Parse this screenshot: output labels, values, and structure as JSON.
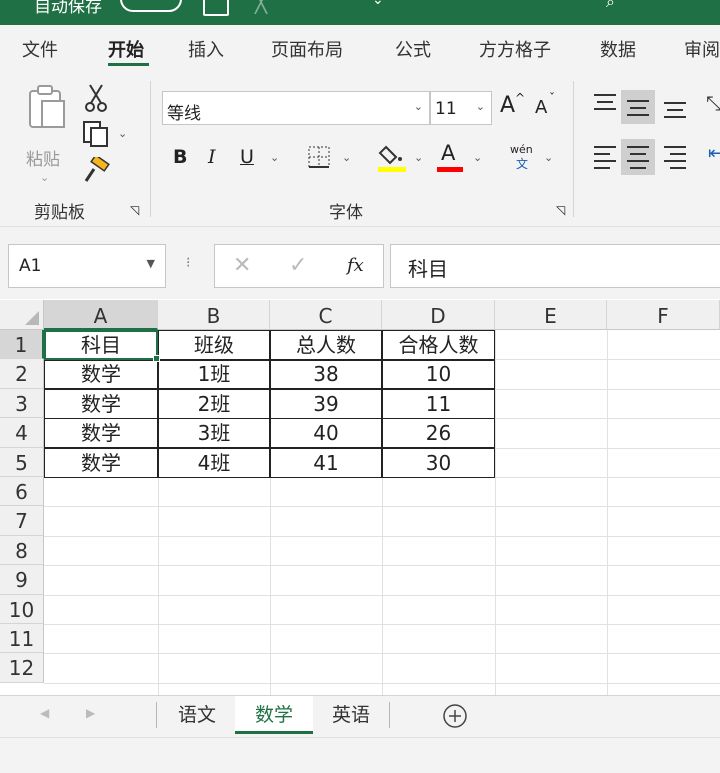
{
  "title_bar": {
    "autosave_label": "自动保存"
  },
  "ribbon_tabs": [
    {
      "label": "文件",
      "active": false
    },
    {
      "label": "开始",
      "active": true
    },
    {
      "label": "插入",
      "active": false
    },
    {
      "label": "页面布局",
      "active": false
    },
    {
      "label": "公式",
      "active": false
    },
    {
      "label": "方方格子",
      "active": false
    },
    {
      "label": "数据",
      "active": false
    },
    {
      "label": "审阅",
      "active": false
    }
  ],
  "clipboard": {
    "paste_label": "粘贴",
    "group_label": "剪贴板"
  },
  "font": {
    "group_label": "字体",
    "font_name": "等线",
    "font_size": "11",
    "grow_font": "A",
    "shrink_font": "A",
    "bold": "B",
    "italic": "I",
    "underline": "U",
    "phonetic_top": "wén",
    "phonetic_bottom": "文",
    "font_color_letter": "A",
    "fill_color": "#ffff00",
    "font_color": "#ff0000"
  },
  "formula_bar": {
    "name_box": "A1",
    "fx_label": "fx",
    "formula": "科目"
  },
  "columns": [
    "A",
    "B",
    "C",
    "D",
    "E",
    "F"
  ],
  "rows": [
    "1",
    "2",
    "3",
    "4",
    "5",
    "6",
    "7",
    "8",
    "9",
    "10",
    "11",
    "12"
  ],
  "cells": [
    [
      "科目",
      "班级",
      "总人数",
      "合格人数"
    ],
    [
      "数学",
      "1班",
      "38",
      "10"
    ],
    [
      "数学",
      "2班",
      "39",
      "11"
    ],
    [
      "数学",
      "3班",
      "40",
      "26"
    ],
    [
      "数学",
      "4班",
      "41",
      "30"
    ]
  ],
  "sheets": [
    {
      "label": "语文",
      "active": false
    },
    {
      "label": "数学",
      "active": true
    },
    {
      "label": "英语",
      "active": false
    }
  ],
  "colors": {
    "accent": "#1f7145"
  }
}
